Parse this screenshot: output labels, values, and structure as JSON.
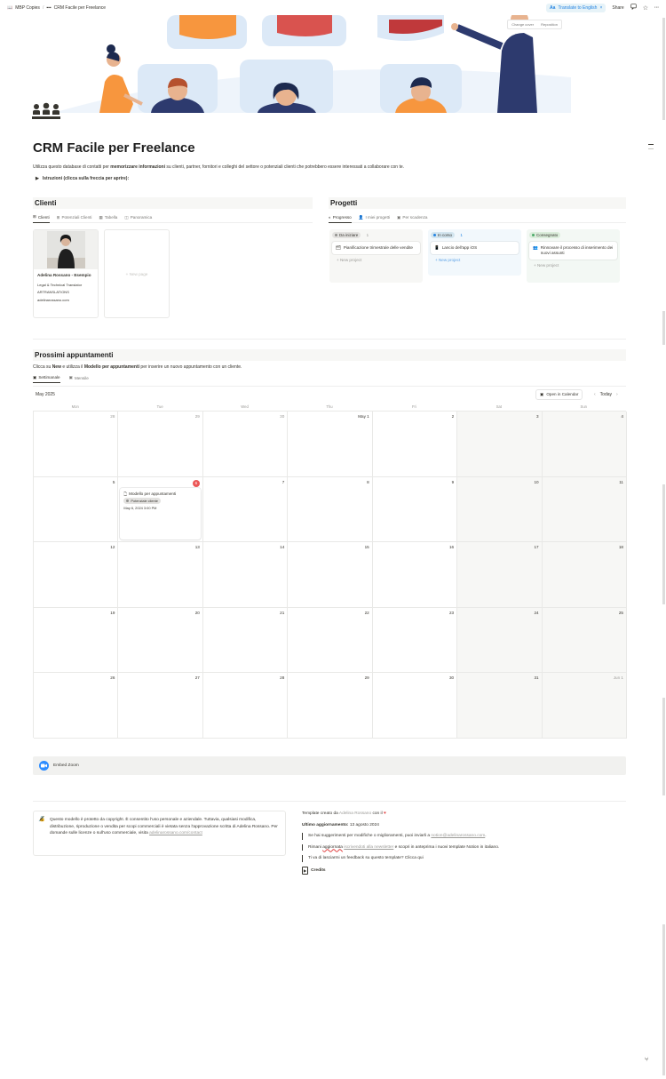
{
  "topbar": {
    "breadcrumb_workspace": "MBP Copies",
    "breadcrumb_page": "CRM Facile per Freelance",
    "translate_label": "Translate to English",
    "share_label": "Share"
  },
  "cover": {
    "change_cover": "Change cover",
    "reposition": "Reposition"
  },
  "page": {
    "title": "CRM Facile per Freelance",
    "intro_pre": "Utilizza questo database di contatti per ",
    "intro_bold": "memorizzare informazioni",
    "intro_post": " su clienti, partner, fornitori e colleghi del settore o potenziali clienti che potrebbero essere interessati a collaborare con te.",
    "toggle_label": "Istruzioni (clicca sulla freccia per aprire):"
  },
  "clienti": {
    "title": "Clienti",
    "tabs": [
      "Clienti",
      "Potenziali Clienti",
      "Tabella",
      "Panoramica"
    ],
    "card": {
      "name": "Adelina Rossano - Esempio",
      "role": "Legal & Technical Translator",
      "company": "ARTRANSLATIONS",
      "site": "adelinarossano.com"
    },
    "new_page": "New page"
  },
  "progetti": {
    "title": "Progetti",
    "tabs": [
      "Progresso",
      "I miei progetti",
      "Per scadenza"
    ],
    "columns": [
      {
        "status": "Da iniziare",
        "count": "1",
        "card": "Pianificazione trimestrale delle vendite",
        "new": "New project"
      },
      {
        "status": "In corso",
        "count": "1",
        "card": "Lancio dell'app iOS",
        "new": "New project"
      },
      {
        "status": "Consegnato",
        "count": "1",
        "card": "Rinnovare il processo di inserimento dei nuovi assunti",
        "new": "New project"
      }
    ]
  },
  "appuntamenti": {
    "title": "Prossimi appuntamenti",
    "desc_pre": "Clicca su ",
    "desc_b1": "New",
    "desc_mid": " e utilizza il ",
    "desc_b2": "Modello per appuntamenti",
    "desc_post": " per inserire un nuovo appuntamento con un cliente.",
    "tabs": [
      "Settimanale",
      "Mensile"
    ],
    "month": "May 2025",
    "open_calendar": "Open in Calendar",
    "today": "Today",
    "weekdays": [
      "Mon",
      "Tue",
      "Wed",
      "Thu",
      "Fri",
      "Sat",
      "Sun"
    ],
    "days": [
      [
        "28",
        "29",
        "30",
        "May 1",
        "2",
        "3",
        "4"
      ],
      [
        "5",
        "6",
        "7",
        "8",
        "9",
        "10",
        "11"
      ],
      [
        "12",
        "13",
        "14",
        "15",
        "16",
        "17",
        "18"
      ],
      [
        "19",
        "20",
        "21",
        "22",
        "23",
        "24",
        "25"
      ],
      [
        "26",
        "27",
        "28",
        "29",
        "30",
        "31",
        "Jun 1"
      ]
    ],
    "event": {
      "title": "Modello per appuntamenti",
      "tag": "Potenziale cliente",
      "date": "May 6, 2024 3:00 PM"
    }
  },
  "embed": {
    "label": "Embed Zoom"
  },
  "footer": {
    "copyright": "Questo modello è protetto da copyright. È consentito l'uso personale e aziendale. Tuttavia, qualsiasi modifica, distribuzione, riproduzione o vendita per scopi commerciali è vietata senza l'approvazione scritta di Adelina Rossano. Per domande sulle licenze o sull'uso commerciale, visita ",
    "copyright_link": "adelinarossano.com/contact",
    "created_pre": "Template creato da ",
    "created_name": "Adelina Rossano",
    "created_post": " con il",
    "updated_label": "Ultimo aggiornamento:",
    "updated_value": " 13 agosto 2024",
    "q1_pre": "Se hai suggerimenti per modifiche o miglioramenti, puoi inviarli a ",
    "q1_link": "notion@adelinarossano.com",
    "q2_pre": "Rimani ",
    "q2_mid": "aggiornata",
    "q2_link": "iscrivendoti alla newsletter",
    "q2_post": " e scopri in anteprima i nuovi template Notion in italiano.",
    "q3": "Ti va di lasciarmi un feedback su questo template? Clicca qui",
    "credits": "Credits"
  }
}
